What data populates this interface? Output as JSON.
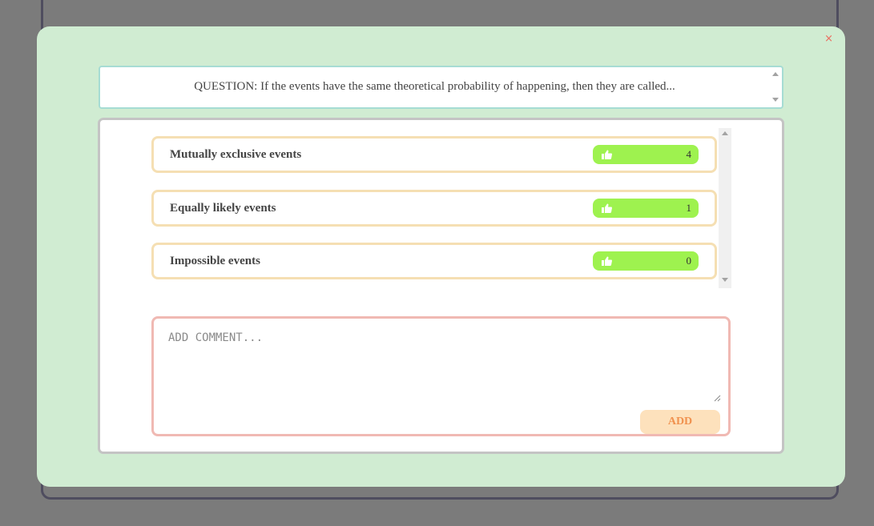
{
  "modal": {
    "close_label": "×"
  },
  "question": {
    "text": "QUESTION: If the events have the same theoretical probability of happening, then they are called..."
  },
  "answers": [
    {
      "label": "Mutually exclusive events",
      "votes": "4"
    },
    {
      "label": "Equally likely events",
      "votes": "1"
    },
    {
      "label": "Impossible events",
      "votes": "0"
    }
  ],
  "comment": {
    "placeholder": "ADD COMMENT...",
    "value": "",
    "add_label": "ADD"
  },
  "colors": {
    "modal_bg": "#d0ecd2",
    "vote_pill": "#9ef24f",
    "question_border": "#a6dcd4",
    "answer_border": "#f5dfb3",
    "comment_border": "#f0b9b3",
    "add_button": "#fde1bc",
    "close_icon": "#ec6b5e"
  },
  "icons": {
    "close": "close-icon",
    "vote": "thumbs-up-icon"
  }
}
